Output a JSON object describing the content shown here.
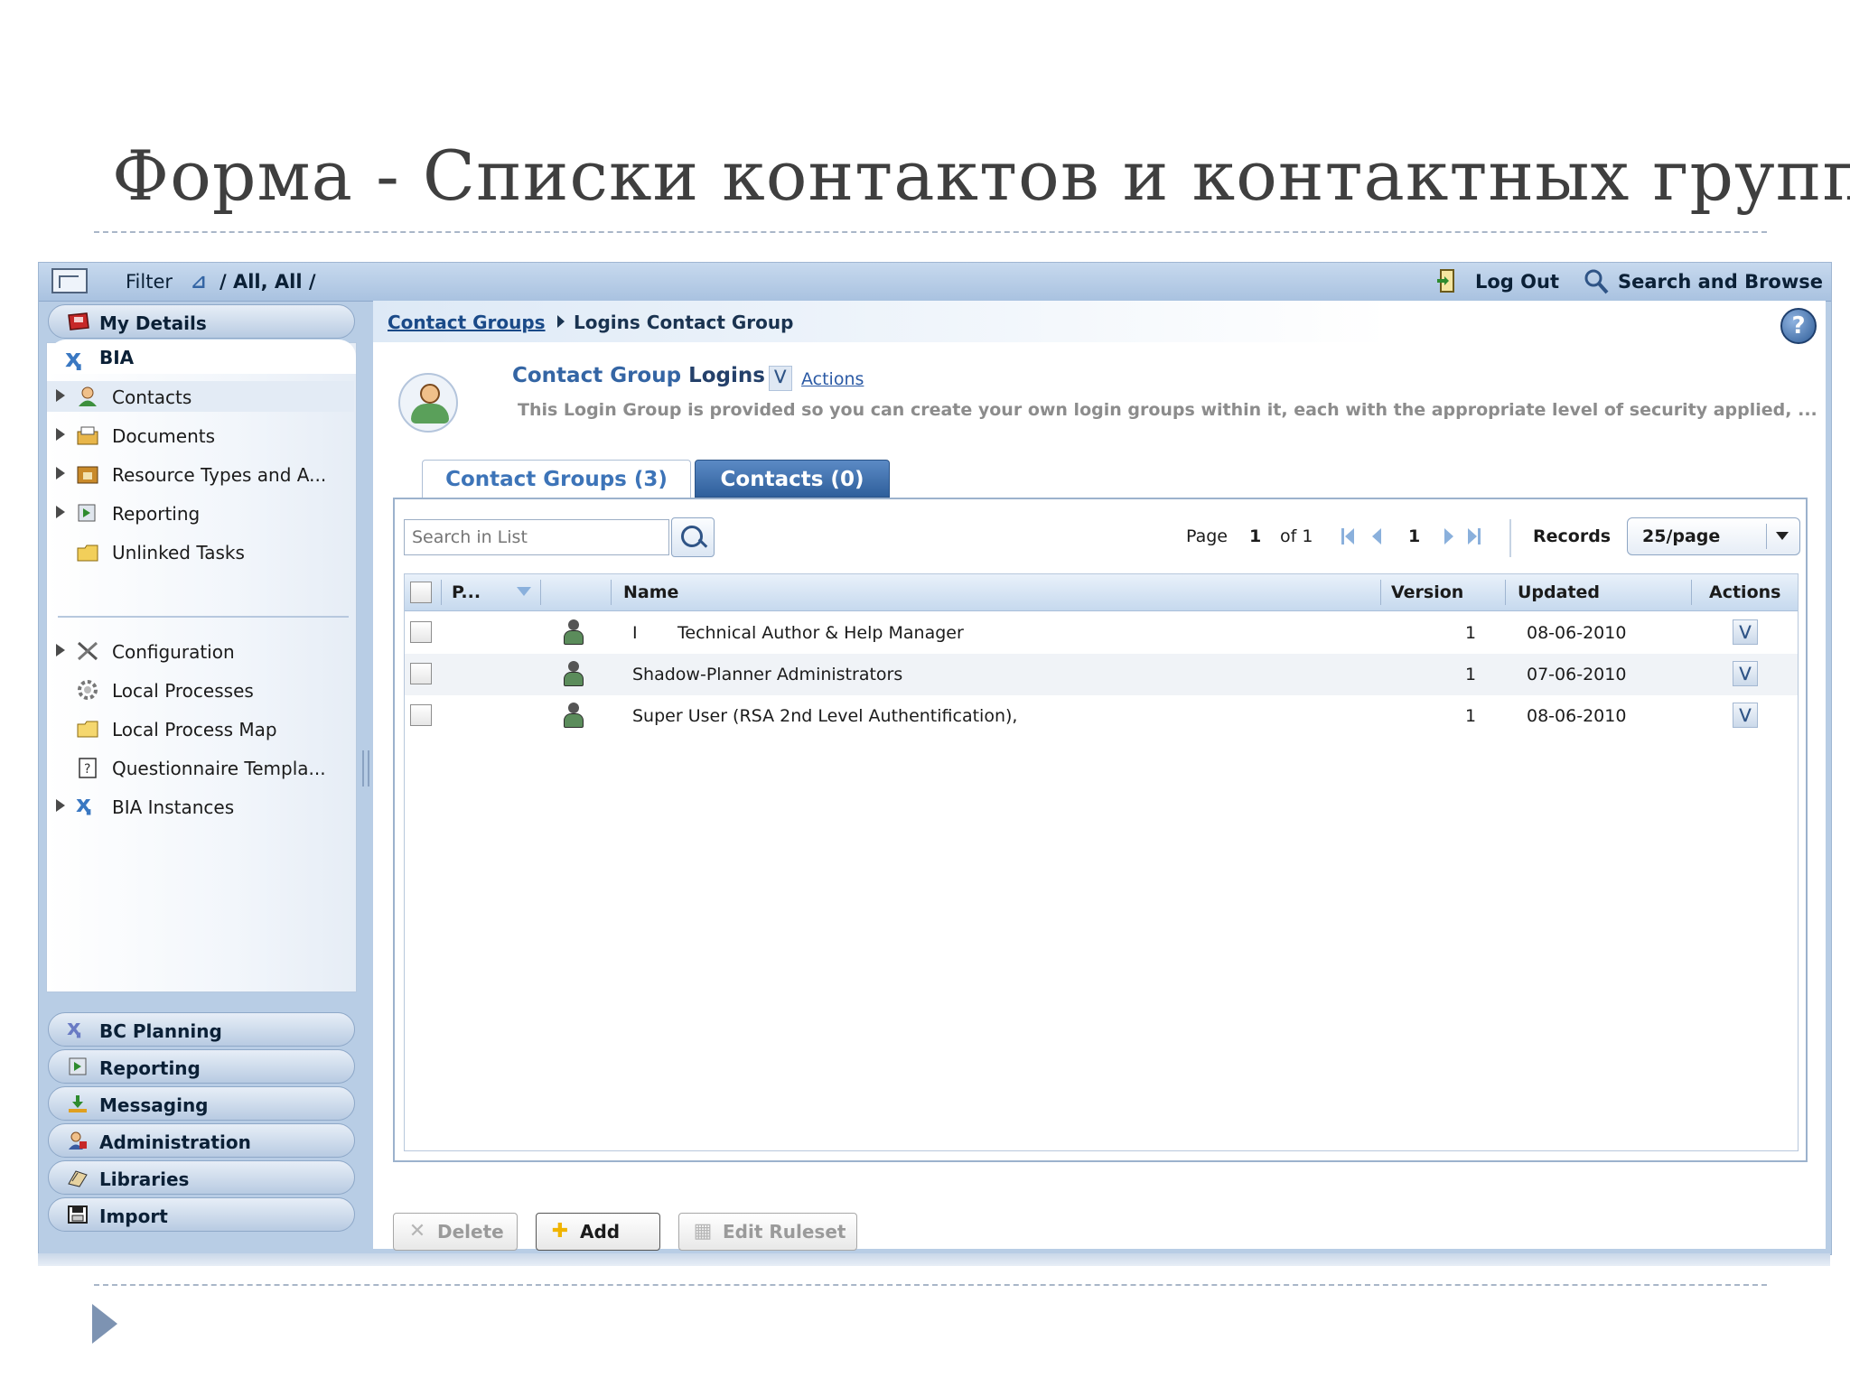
{
  "slide": {
    "title": "Форма - Списки контактов и контактных групп"
  },
  "topbar": {
    "filter_label": "Filter",
    "filter_value": "/ All, All /",
    "logout_label": "Log Out",
    "search_browse_label": "Search and Browse"
  },
  "sidebar": {
    "my_details": "My Details",
    "bia": "BIA",
    "tree": [
      {
        "label": "Contacts",
        "icon": "contacts-icon",
        "expandable": true
      },
      {
        "label": "Documents",
        "icon": "documents-icon",
        "expandable": true
      },
      {
        "label": "Resource Types and A...",
        "icon": "resource-types-icon",
        "expandable": true
      },
      {
        "label": "Reporting",
        "icon": "reporting-icon",
        "expandable": true
      },
      {
        "label": "Unlinked Tasks",
        "icon": "unlinked-tasks-icon",
        "expandable": false
      },
      {
        "label": "Configuration",
        "icon": "configuration-icon",
        "expandable": true
      },
      {
        "label": "Local Processes",
        "icon": "gear-icon",
        "expandable": false
      },
      {
        "label": "Local Process Map",
        "icon": "folder-icon",
        "expandable": false
      },
      {
        "label": "Questionnaire Templa...",
        "icon": "questionnaire-icon",
        "expandable": false
      },
      {
        "label": "BIA Instances",
        "icon": "bia-icon",
        "expandable": true
      }
    ],
    "sections": [
      "BC Planning",
      "Reporting",
      "Messaging",
      "Administration",
      "Libraries",
      "Import"
    ]
  },
  "breadcrumb": {
    "link": "Contact Groups",
    "current": "Logins Contact Group"
  },
  "header": {
    "title_part1": "Contact Group",
    "title_part2": "Logins",
    "actions_link": "Actions",
    "description": "This Login Group is provided so you can create your own  login groups within it, each with the appropriate level of security applied, ..."
  },
  "tabs": [
    {
      "label": "Contact Groups  (3)",
      "active": true
    },
    {
      "label": "Contacts  (0)",
      "active": false
    }
  ],
  "toolbar": {
    "search_placeholder": "Search in List",
    "page_label": "Page",
    "page_current": "1",
    "page_of": "of 1",
    "page_input": "1",
    "records_label": "Records",
    "records_value": "25/page"
  },
  "table": {
    "columns": {
      "p": "P...",
      "name": "Name",
      "version": "Version",
      "updated": "Updated",
      "actions": "Actions"
    },
    "rows": [
      {
        "prefix": "I",
        "name": "Technical Author & Help Manager",
        "version": "1",
        "updated": "08-06-2010"
      },
      {
        "prefix": "",
        "name": "Shadow-Planner Administrators",
        "version": "1",
        "updated": "07-06-2010"
      },
      {
        "prefix": "",
        "name": "Super User (RSA 2nd Level Authentification),",
        "version": "1",
        "updated": "08-06-2010"
      }
    ]
  },
  "buttons": {
    "delete": "Delete",
    "add": "Add",
    "edit_ruleset": "Edit Ruleset"
  }
}
